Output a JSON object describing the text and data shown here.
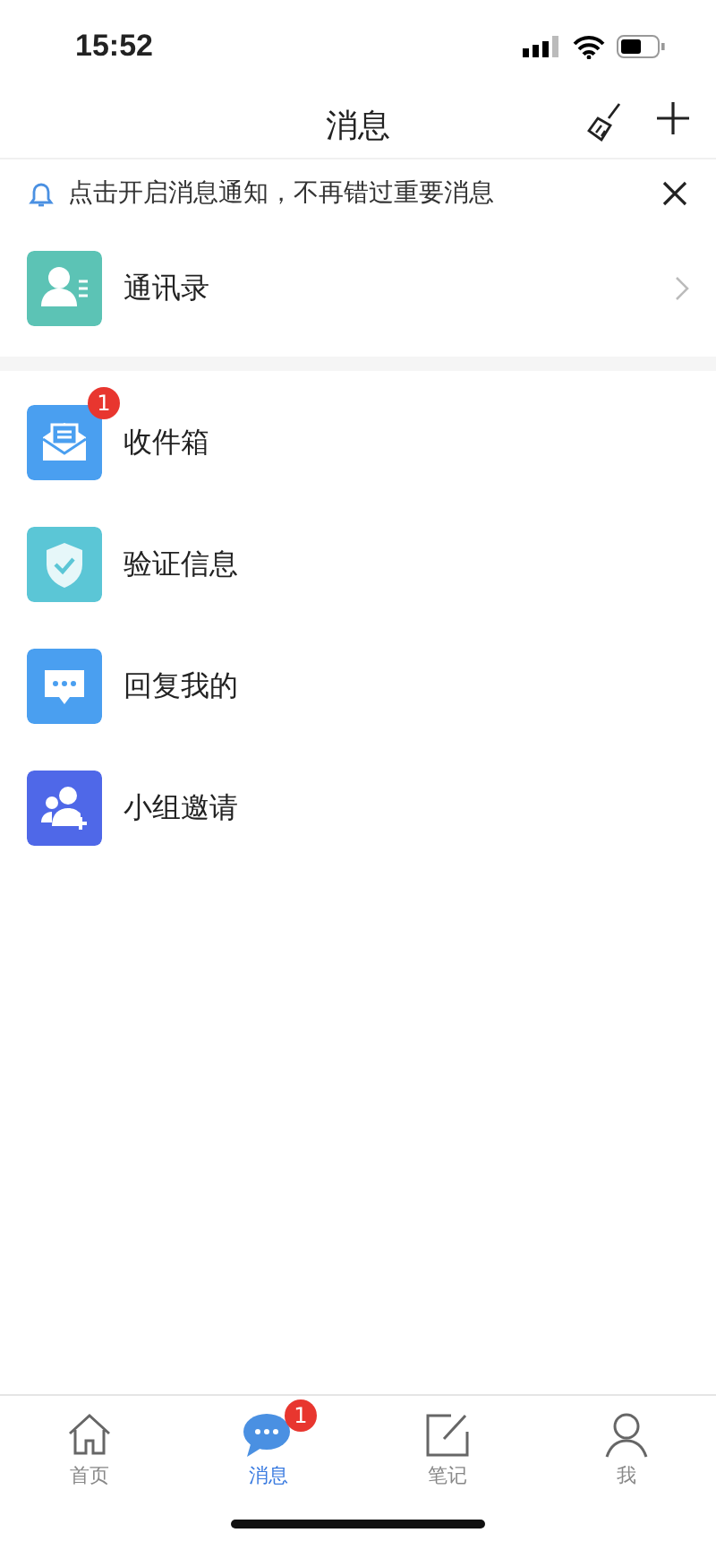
{
  "status_bar": {
    "time": "15:52"
  },
  "header": {
    "title": "消息"
  },
  "notice": {
    "text": "点击开启消息通知，不再错过重要消息"
  },
  "contacts": {
    "label": "通讯录",
    "kind": "contact",
    "color": "#5cc3b5"
  },
  "items": [
    {
      "label": "收件箱",
      "kind": "envelope",
      "color": "#4a9ff0",
      "badge": "1"
    },
    {
      "label": "验证信息",
      "kind": "shield",
      "color": "#5bc6d6"
    },
    {
      "label": "回复我的",
      "kind": "chat",
      "color": "#4a9ff0"
    },
    {
      "label": "小组邀请",
      "kind": "group",
      "color": "#4f68e8"
    }
  ],
  "tabs": [
    {
      "label": "首页",
      "kind": "home",
      "selected": false
    },
    {
      "label": "消息",
      "kind": "chat",
      "selected": true,
      "badge": "1"
    },
    {
      "label": "笔记",
      "kind": "note",
      "selected": false
    },
    {
      "label": "我",
      "kind": "person",
      "selected": false
    }
  ]
}
